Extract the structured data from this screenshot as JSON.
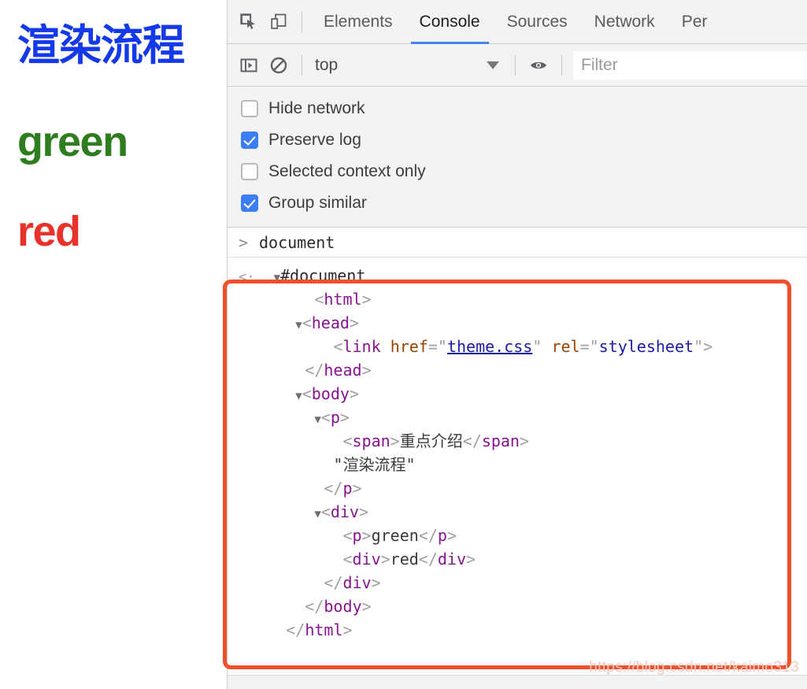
{
  "preview": {
    "heading": "渲染流程",
    "heading_color": "#1439e8",
    "line_green": "green",
    "green_color": "#2e7d1e",
    "line_red": "red",
    "red_color": "#e8322a"
  },
  "devtools": {
    "toolbar_icons": [
      {
        "name": "inspect-element-icon",
        "title": "Inspect element"
      },
      {
        "name": "device-toolbar-icon",
        "title": "Toggle device toolbar"
      }
    ],
    "tabs": [
      {
        "label": "Elements",
        "active": false
      },
      {
        "label": "Console",
        "active": true
      },
      {
        "label": "Sources",
        "active": false
      },
      {
        "label": "Network",
        "active": false
      },
      {
        "label": "Per",
        "active": false
      }
    ],
    "active_tab_underline_color": "#4285f4",
    "console_toolbar": {
      "sidebar_toggle_icon": "sidebar-toggle-icon",
      "clear_console_icon": "clear-console-icon",
      "context_value": "top",
      "context_caret_icon": "chevron-down-icon",
      "live_expression_icon": "eye-icon",
      "filter_value": "",
      "filter_placeholder": "Filter"
    },
    "filters": [
      {
        "label": "Hide network",
        "checked": false
      },
      {
        "label": "Preserve log",
        "checked": true
      },
      {
        "label": "Selected context only",
        "checked": false
      },
      {
        "label": "Group similar",
        "checked": true
      }
    ],
    "checkbox_accent_color": "#3b7ef3",
    "console_entries": {
      "prompt_symbol": ">",
      "prompt_expression": "document",
      "response_symbol": "<·"
    },
    "dom_tree": {
      "root_label": "#document",
      "lines": [
        {
          "indent": 0,
          "triangle": "▼",
          "text": "#document",
          "kind": "docnode"
        },
        {
          "indent": 1,
          "triangle": "",
          "text": "<html>",
          "kind": "tag"
        },
        {
          "indent": 1,
          "triangle": "▼",
          "text": "<head>",
          "kind": "tag"
        },
        {
          "indent": 2,
          "triangle": "",
          "text": "<link href=\"theme.css\" rel=\"stylesheet\">",
          "kind": "link-tag"
        },
        {
          "indent": 1,
          "triangle": "",
          "text": "</head>",
          "kind": "tag"
        },
        {
          "indent": 1,
          "triangle": "▼",
          "text": "<body>",
          "kind": "tag"
        },
        {
          "indent": 2,
          "triangle": "▼",
          "text": "<p>",
          "kind": "tag"
        },
        {
          "indent": 3,
          "triangle": "",
          "text": "<span>重点介绍</span>",
          "kind": "span-line"
        },
        {
          "indent": 3,
          "triangle": "",
          "text": "\"渲染流程\"",
          "kind": "textnode"
        },
        {
          "indent": 2,
          "triangle": "",
          "text": "</p>",
          "kind": "tag"
        },
        {
          "indent": 2,
          "triangle": "▼",
          "text": "<div>",
          "kind": "tag"
        },
        {
          "indent": 3,
          "triangle": "",
          "text": "<p>green</p>",
          "kind": "p-green"
        },
        {
          "indent": 3,
          "triangle": "",
          "text": "<div>red</div>",
          "kind": "div-red"
        },
        {
          "indent": 2,
          "triangle": "",
          "text": "</div>",
          "kind": "tag"
        },
        {
          "indent": 1,
          "triangle": "",
          "text": "</body>",
          "kind": "tag"
        },
        {
          "indent": 0,
          "triangle": "",
          "text": "</html>",
          "kind": "tag"
        }
      ],
      "link_href_value": "theme.css",
      "link_rel_value": "stylesheet",
      "span_text": "重点介绍",
      "p_text_node": "\"渲染流程\"",
      "p_green_text": "green",
      "div_red_text": "red"
    },
    "annotation_box_color": "#f0502a"
  },
  "watermark": "https://blog.csdn.net/kaimo313"
}
